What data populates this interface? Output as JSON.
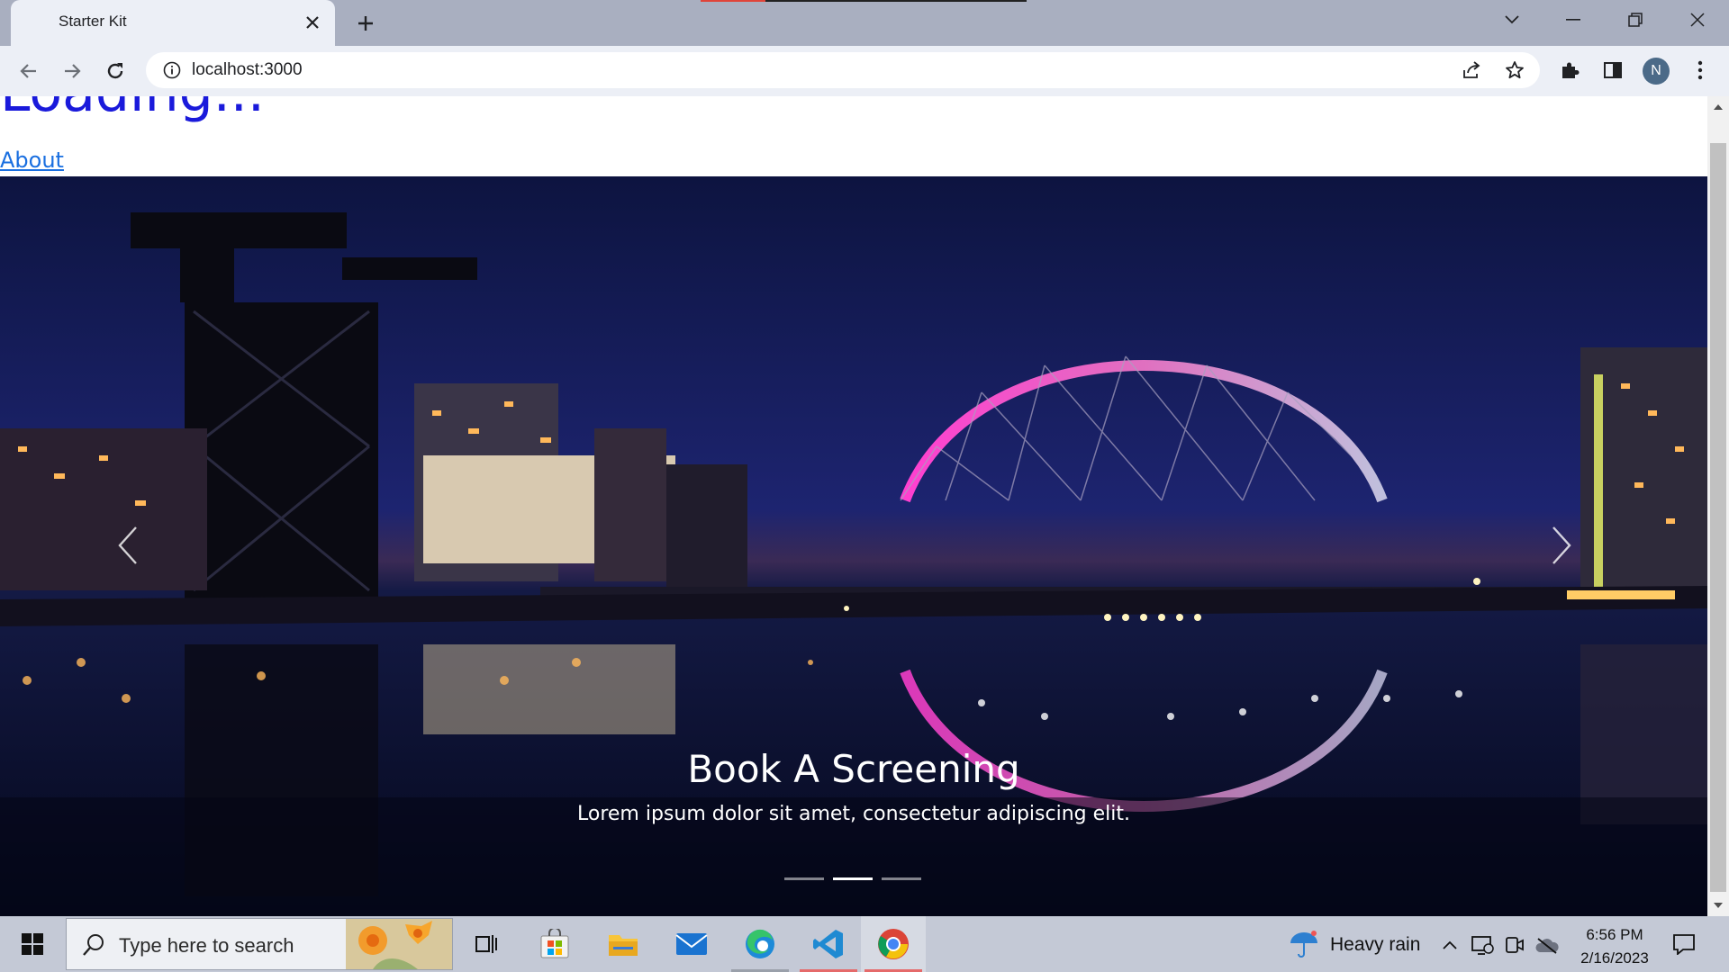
{
  "browser": {
    "tab_title": "Starter Kit",
    "url": "localhost:3000",
    "profile_initial": "N"
  },
  "page": {
    "heading": "Loading...",
    "nav_link": "About",
    "carousel": {
      "caption_title": "Book A Screening",
      "caption_text": "Lorem ipsum dolor sit amet, consectetur adipiscing elit.",
      "slide_count": 3,
      "active_slide": 2
    }
  },
  "taskbar": {
    "search_placeholder": "Type here to search",
    "weather": "Heavy rain",
    "time": "6:56 PM",
    "date": "2/16/2023"
  },
  "colors": {
    "titlebar": "#a9afc0",
    "toolbar": "#eceff6",
    "heading": "#1a1adb",
    "link": "#1a6fe0",
    "taskbar": "#c4c9d6"
  }
}
